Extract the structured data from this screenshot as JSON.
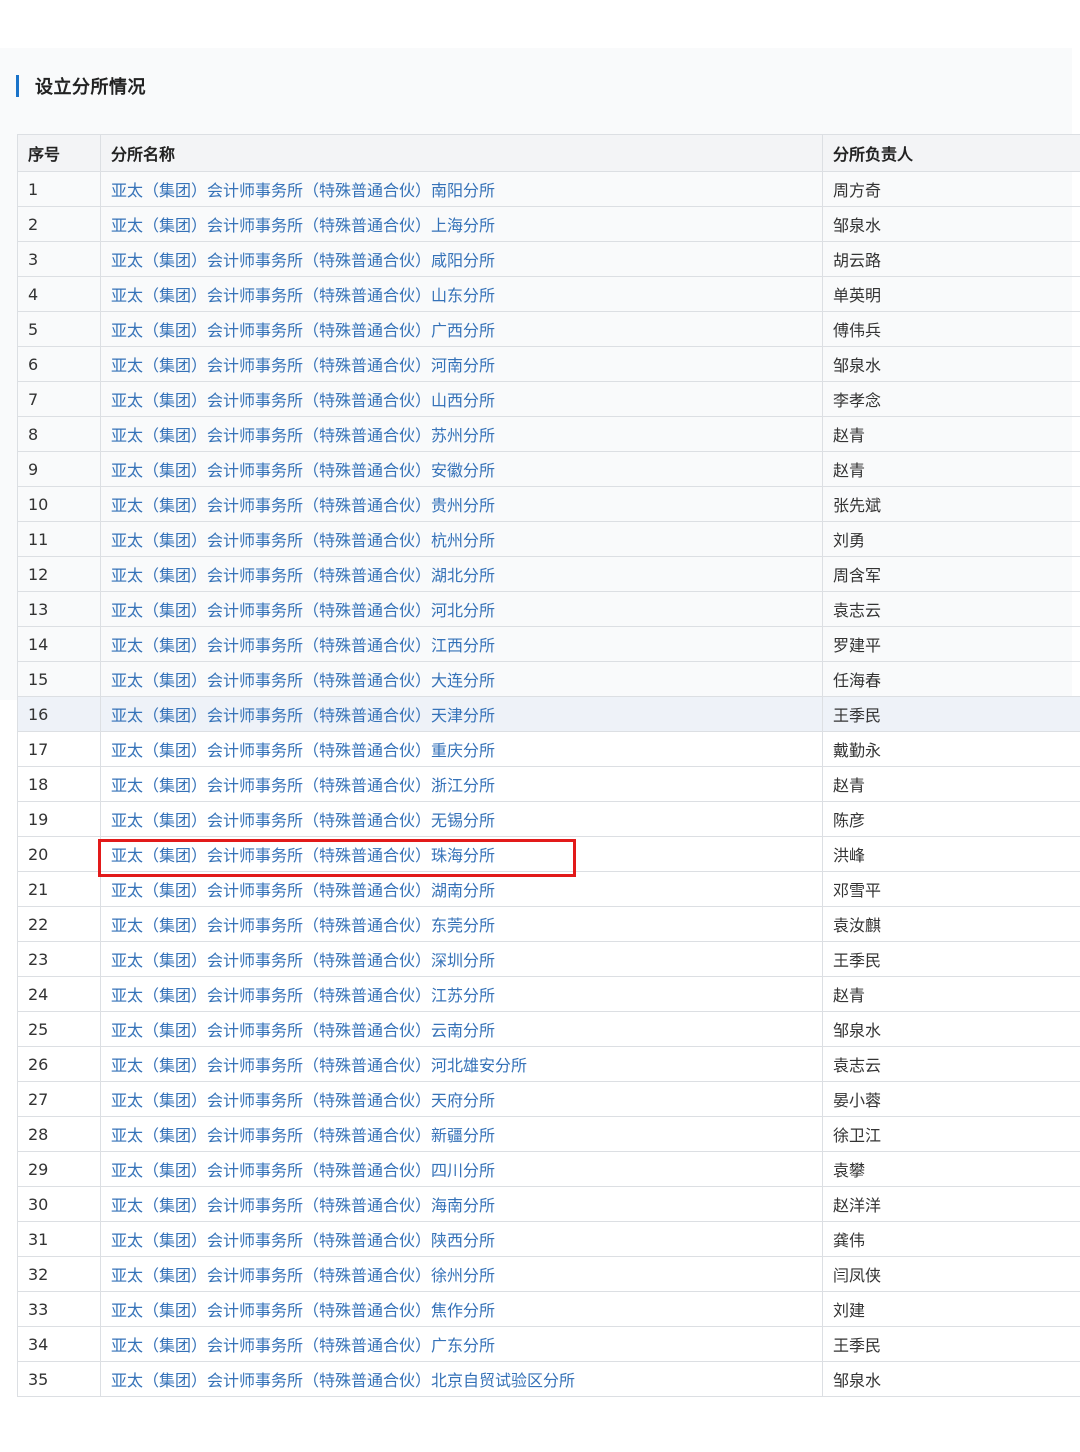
{
  "section": {
    "title": "设立分所情况"
  },
  "table": {
    "headers": [
      "序号",
      "分所名称",
      "分所负责人"
    ],
    "rows": [
      {
        "no": "1",
        "name": "亚太（集团）会计师事务所（特殊普通合伙）南阳分所",
        "head": "周方奇"
      },
      {
        "no": "2",
        "name": "亚太（集团）会计师事务所（特殊普通合伙）上海分所",
        "head": "邹泉水"
      },
      {
        "no": "3",
        "name": "亚太（集团）会计师事务所（特殊普通合伙）咸阳分所",
        "head": "胡云路"
      },
      {
        "no": "4",
        "name": "亚太（集团）会计师事务所（特殊普通合伙）山东分所",
        "head": "单英明"
      },
      {
        "no": "5",
        "name": "亚太（集团）会计师事务所（特殊普通合伙）广西分所",
        "head": "傅伟兵"
      },
      {
        "no": "6",
        "name": "亚太（集团）会计师事务所（特殊普通合伙）河南分所",
        "head": "邹泉水"
      },
      {
        "no": "7",
        "name": "亚太（集团）会计师事务所（特殊普通合伙）山西分所",
        "head": "李孝念"
      },
      {
        "no": "8",
        "name": "亚太（集团）会计师事务所（特殊普通合伙）苏州分所",
        "head": "赵青"
      },
      {
        "no": "9",
        "name": "亚太（集团）会计师事务所（特殊普通合伙）安徽分所",
        "head": "赵青"
      },
      {
        "no": "10",
        "name": "亚太（集团）会计师事务所（特殊普通合伙）贵州分所",
        "head": "张先斌"
      },
      {
        "no": "11",
        "name": "亚太（集团）会计师事务所（特殊普通合伙）杭州分所",
        "head": "刘勇"
      },
      {
        "no": "12",
        "name": "亚太（集团）会计师事务所（特殊普通合伙）湖北分所",
        "head": "周含军"
      },
      {
        "no": "13",
        "name": "亚太（集团）会计师事务所（特殊普通合伙）河北分所",
        "head": "袁志云"
      },
      {
        "no": "14",
        "name": "亚太（集团）会计师事务所（特殊普通合伙）江西分所",
        "head": "罗建平"
      },
      {
        "no": "15",
        "name": "亚太（集团）会计师事务所（特殊普通合伙）大连分所",
        "head": "任海春"
      },
      {
        "no": "16",
        "name": "亚太（集团）会计师事务所（特殊普通合伙）天津分所",
        "head": "王季民"
      },
      {
        "no": "17",
        "name": "亚太（集团）会计师事务所（特殊普通合伙）重庆分所",
        "head": "戴勤永"
      },
      {
        "no": "18",
        "name": "亚太（集团）会计师事务所（特殊普通合伙）浙江分所",
        "head": "赵青"
      },
      {
        "no": "19",
        "name": "亚太（集团）会计师事务所（特殊普通合伙）无锡分所",
        "head": "陈彦"
      },
      {
        "no": "20",
        "name": "亚太（集团）会计师事务所（特殊普通合伙）珠海分所",
        "head": "洪峰"
      },
      {
        "no": "21",
        "name": "亚太（集团）会计师事务所（特殊普通合伙）湖南分所",
        "head": "邓雪平"
      },
      {
        "no": "22",
        "name": "亚太（集团）会计师事务所（特殊普通合伙）东莞分所",
        "head": "袁汝麒"
      },
      {
        "no": "23",
        "name": "亚太（集团）会计师事务所（特殊普通合伙）深圳分所",
        "head": "王季民"
      },
      {
        "no": "24",
        "name": "亚太（集团）会计师事务所（特殊普通合伙）江苏分所",
        "head": "赵青"
      },
      {
        "no": "25",
        "name": "亚太（集团）会计师事务所（特殊普通合伙）云南分所",
        "head": "邹泉水"
      },
      {
        "no": "26",
        "name": "亚太（集团）会计师事务所（特殊普通合伙）河北雄安分所",
        "head": "袁志云"
      },
      {
        "no": "27",
        "name": "亚太（集团）会计师事务所（特殊普通合伙）天府分所",
        "head": "晏小蓉"
      },
      {
        "no": "28",
        "name": "亚太（集团）会计师事务所（特殊普通合伙）新疆分所",
        "head": "徐卫江"
      },
      {
        "no": "29",
        "name": "亚太（集团）会计师事务所（特殊普通合伙）四川分所",
        "head": "袁攀"
      },
      {
        "no": "30",
        "name": "亚太（集团）会计师事务所（特殊普通合伙）海南分所",
        "head": "赵洋洋"
      },
      {
        "no": "31",
        "name": "亚太（集团）会计师事务所（特殊普通合伙）陕西分所",
        "head": "龚伟"
      },
      {
        "no": "32",
        "name": "亚太（集团）会计师事务所（特殊普通合伙）徐州分所",
        "head": "闫凤侠"
      },
      {
        "no": "33",
        "name": "亚太（集团）会计师事务所（特殊普通合伙）焦作分所",
        "head": "刘建"
      },
      {
        "no": "34",
        "name": "亚太（集团）会计师事务所（特殊普通合伙）广东分所",
        "head": "王季民"
      },
      {
        "no": "35",
        "name": "亚太（集团）会计师事务所（特殊普通合伙）北京自贸试验区分所",
        "head": "邹泉水"
      }
    ],
    "highlighted_row": "16",
    "marked_row": "20"
  },
  "colors": {
    "accent": "#1a73c9",
    "link": "#3572b8",
    "marker": "#e21a1a",
    "row_highlight": "#eef2f8"
  }
}
